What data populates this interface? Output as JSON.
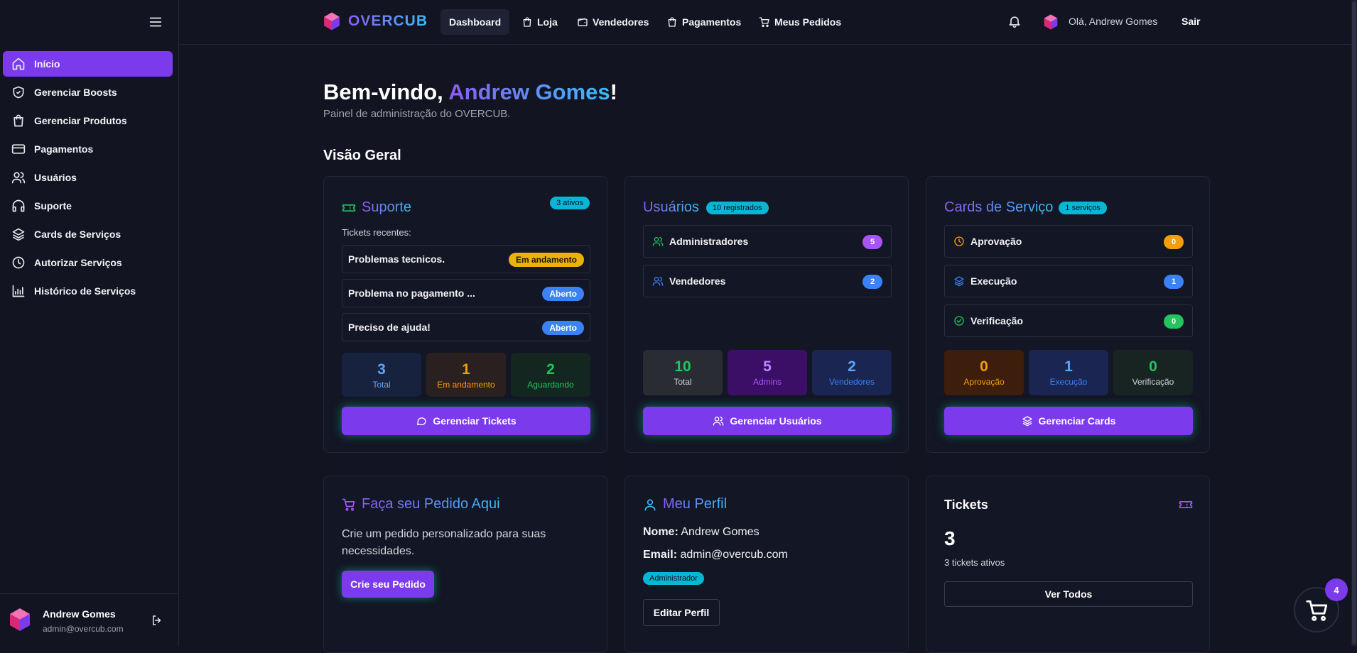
{
  "brand": {
    "name": "OVERCUB"
  },
  "topnav": {
    "items": [
      {
        "label": "Dashboard",
        "icon": "none"
      },
      {
        "label": "Loja",
        "icon": "shopping-bag-icon"
      },
      {
        "label": "Vendedores",
        "icon": "wallet-icon"
      },
      {
        "label": "Pagamentos",
        "icon": "shopping-bag-icon"
      },
      {
        "label": "Meus Pedidos",
        "icon": "cart-icon"
      }
    ],
    "greeting": "Olá, Andrew Gomes",
    "logout": "Sair"
  },
  "sidebar": {
    "items": [
      {
        "label": "Início",
        "icon": "home-icon"
      },
      {
        "label": "Gerenciar Boosts",
        "icon": "shield-icon"
      },
      {
        "label": "Gerenciar Produtos",
        "icon": "shopping-bag-icon"
      },
      {
        "label": "Pagamentos",
        "icon": "credit-card-icon"
      },
      {
        "label": "Usuários",
        "icon": "users-icon"
      },
      {
        "label": "Suporte",
        "icon": "headphones-icon"
      },
      {
        "label": "Cards de Serviços",
        "icon": "layers-icon"
      },
      {
        "label": "Autorizar Serviços",
        "icon": "clock-icon"
      },
      {
        "label": "Histórico de Serviços",
        "icon": "bar-chart-icon"
      }
    ],
    "user": {
      "name": "Andrew Gomes",
      "email": "admin@overcub.com"
    }
  },
  "header": {
    "welcome_prefix": "Bem-vindo, ",
    "welcome_name": "Andrew Gomes",
    "welcome_suffix": "!",
    "subtitle": "Painel de administração do OVERCUB.",
    "section_title": "Visão Geral"
  },
  "support": {
    "title": "Suporte",
    "badge": "3 ativos",
    "recent_label": "Tickets recentes:",
    "tickets": [
      {
        "title": "Problemas tecnicos.",
        "status": "Em andamento"
      },
      {
        "title": "Problema no pagamento ...",
        "status": "Aberto"
      },
      {
        "title": "Preciso de ajuda!",
        "status": "Aberto"
      }
    ],
    "stats": [
      {
        "value": "3",
        "label": "Total"
      },
      {
        "value": "1",
        "label": "Em andamento"
      },
      {
        "value": "2",
        "label": "Aguardando"
      }
    ],
    "button": "Gerenciar Tickets"
  },
  "users": {
    "title": "Usuários",
    "badge": "10 registrados",
    "rows": [
      {
        "label": "Administradores",
        "count": "5"
      },
      {
        "label": "Vendedores",
        "count": "2"
      }
    ],
    "stats": [
      {
        "value": "10",
        "label": "Total"
      },
      {
        "value": "5",
        "label": "Admins"
      },
      {
        "value": "2",
        "label": "Vendedores"
      }
    ],
    "button": "Gerenciar Usuários"
  },
  "service_cards": {
    "title": "Cards de Serviço",
    "badge": "1 serviços",
    "rows": [
      {
        "label": "Aprovação",
        "count": "0"
      },
      {
        "label": "Execução",
        "count": "1"
      },
      {
        "label": "Verificação",
        "count": "0"
      }
    ],
    "stats": [
      {
        "value": "0",
        "label": "Aprovação"
      },
      {
        "value": "1",
        "label": "Execução"
      },
      {
        "value": "0",
        "label": "Verificação"
      }
    ],
    "button": "Gerenciar Cards"
  },
  "order": {
    "title": "Faça seu Pedido Aqui",
    "text": "Crie um pedido personalizado para suas necessidades.",
    "button": "Crie seu Pedido"
  },
  "profile": {
    "title": "Meu Perfil",
    "name_label": "Nome:",
    "name_value": "Andrew Gomes",
    "email_label": "Email:",
    "email_value": "admin@overcub.com",
    "role": "Administrador",
    "button": "Editar Perfil"
  },
  "tickets_card": {
    "title": "Tickets",
    "count": "3",
    "caption": "3 tickets ativos",
    "button": "Ver Todos"
  },
  "cart": {
    "count": "4"
  },
  "colors": {
    "accent": "#7c3aed",
    "cyan": "#06b6d4",
    "background": "#121422",
    "amber": "#eab308",
    "blue": "#3b82f6",
    "green": "#22c55e"
  }
}
